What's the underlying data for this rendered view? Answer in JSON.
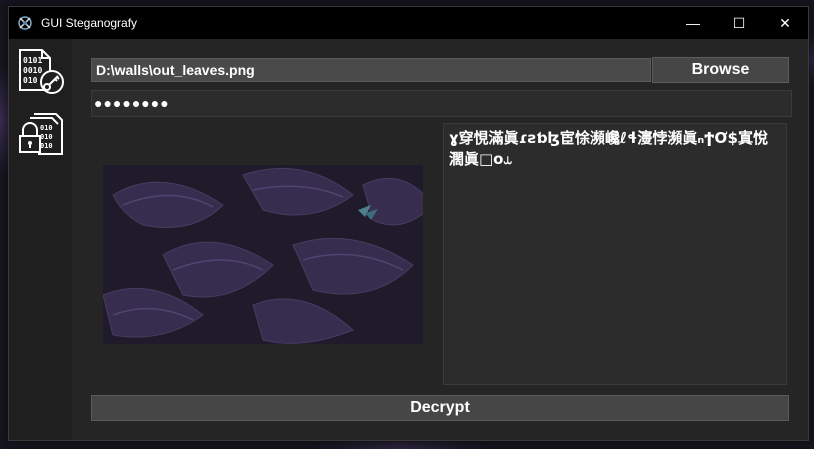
{
  "window": {
    "title": "GUI Steganografy",
    "controls": {
      "minimize": "—",
      "maximize": "☐",
      "close": "✕"
    }
  },
  "sidebar": {
    "items": [
      {
        "name": "encrypt",
        "icon": "binary-document-key-icon"
      },
      {
        "name": "decrypt",
        "icon": "lock-binary-document-icon"
      }
    ]
  },
  "main": {
    "file_path": "D:\\walls\\out_leaves.png",
    "browse_label": "Browse",
    "password_masked": "●●●●●●●●",
    "output_text": "ɣ穿悓滿眞ɾƨƅɮ宦悇瀕巉ℓɬ濅悖瀕眞ₙϮƠ$寘悅濶眞□ο⥿",
    "decrypt_label": "Decrypt"
  },
  "colors": {
    "background": "#252525",
    "titlebar": "#000000",
    "button": "#464646",
    "input": "#2c2c2c"
  }
}
